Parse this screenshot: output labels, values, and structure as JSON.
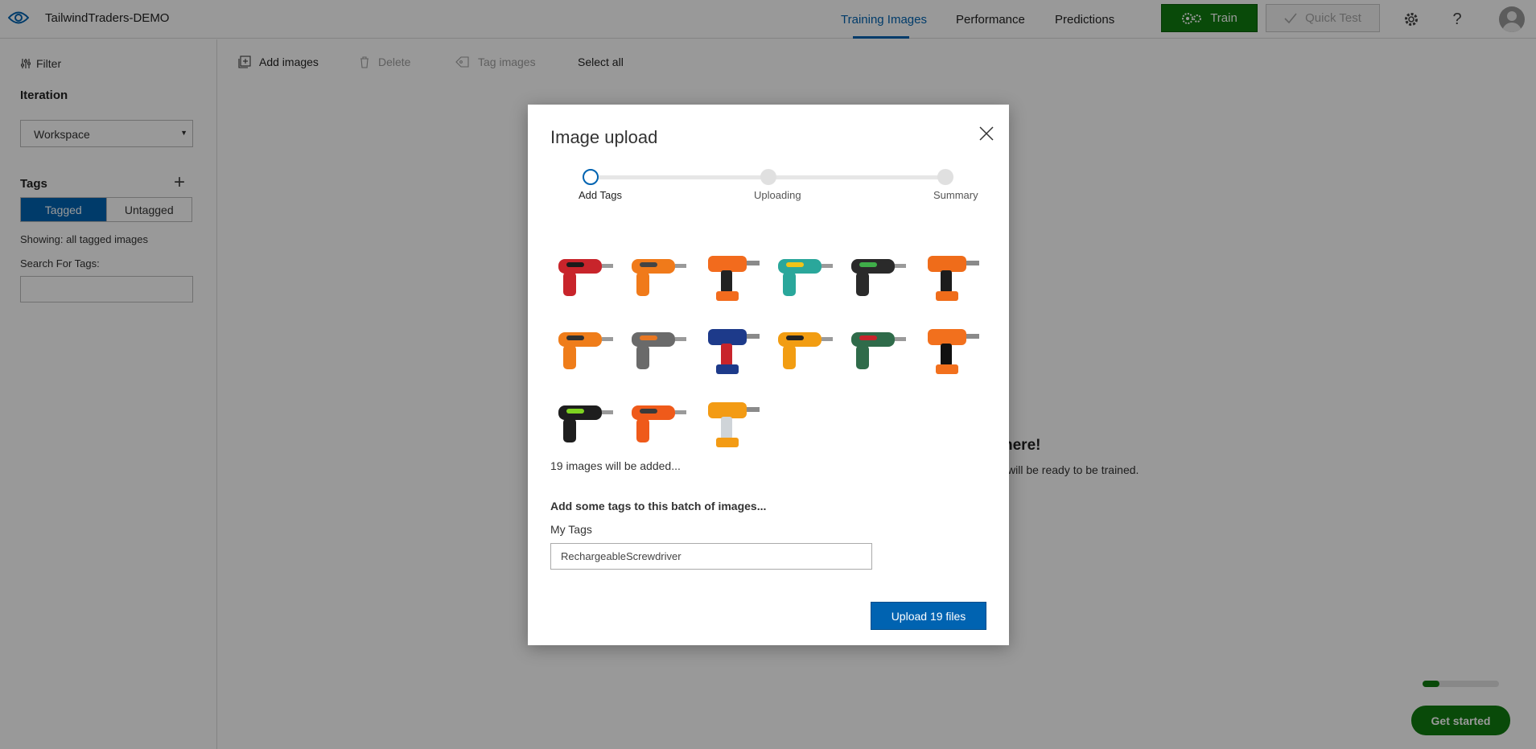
{
  "header": {
    "project_name": "TailwindTraders-DEMO",
    "nav": [
      "Training Images",
      "Performance",
      "Predictions"
    ],
    "active_nav": "Training Images",
    "train_label": "Train",
    "quick_test_label": "Quick Test",
    "icons": [
      "eye-logo-icon",
      "gears-icon",
      "check-icon",
      "gear-icon",
      "help-icon",
      "avatar"
    ]
  },
  "sidebar": {
    "filter_label": "Filter",
    "iteration_heading": "Iteration",
    "iteration_value": "Workspace",
    "tags_heading": "Tags",
    "tagged_label": "Tagged",
    "untagged_label": "Untagged",
    "showing_text": "Showing: all tagged images",
    "search_label": "Search For Tags:",
    "search_value": ""
  },
  "toolbar": {
    "add_images": "Add images",
    "delete": "Delete",
    "tag_images": "Tag images",
    "select_all": "Select all"
  },
  "background": {
    "heading_fragment": "here!",
    "sub_fragment": "will be ready to be trained.",
    "progress_fraction": 0.22,
    "get_started": "Get started"
  },
  "modal": {
    "title": "Image upload",
    "steps": [
      "Add Tags",
      "Uploading",
      "Summary"
    ],
    "current_step": 0,
    "thumbnails": [
      {
        "name": "red-screwdriver",
        "color": "#c8242b",
        "accent": "#1a1a1a"
      },
      {
        "name": "orange-screwdriver",
        "color": "#f07a1a",
        "accent": "#444444"
      },
      {
        "name": "orange-drill-12v",
        "color": "#f26b1d",
        "accent": "#222222"
      },
      {
        "name": "teal-screwdriver-kit",
        "color": "#2aa79b",
        "accent": "#f0c419"
      },
      {
        "name": "black-drill-kit",
        "color": "#2a2a2a",
        "accent": "#3fae49"
      },
      {
        "name": "orange-inline-driver",
        "color": "#ef6c1a",
        "accent": "#1c1c1c"
      },
      {
        "name": "worx-screwdriver",
        "color": "#ef7d1a",
        "accent": "#303030"
      },
      {
        "name": "grey-driver",
        "color": "#6a6a6a",
        "accent": "#e87722"
      },
      {
        "name": "blue-screwdriver",
        "color": "#1d3a8a",
        "accent": "#c8242b"
      },
      {
        "name": "yellow-screwdriver",
        "color": "#f29d12",
        "accent": "#222222"
      },
      {
        "name": "bosch-ixo",
        "color": "#2f6b4a",
        "accent": "#c8242b"
      },
      {
        "name": "orange-pistol-driver",
        "color": "#f2701d",
        "accent": "#111111"
      },
      {
        "name": "green-black-drill",
        "color": "#1e1e1e",
        "accent": "#7ed321"
      },
      {
        "name": "orange-large-driver",
        "color": "#ef5a1a",
        "accent": "#3a3a3a"
      },
      {
        "name": "orange-corded-driver",
        "color": "#f39b14",
        "accent": "#cfd4d8"
      }
    ],
    "count_text": "19 images will be added...",
    "add_tags_prompt": "Add some tags to this batch of images...",
    "my_tags_label": "My Tags",
    "tag_value": "RechargeableScrewdriver",
    "upload_label": "Upload 19 files"
  }
}
